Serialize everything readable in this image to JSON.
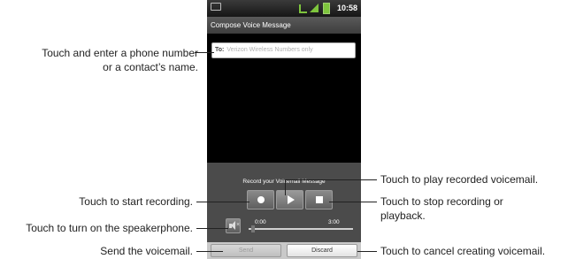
{
  "status_bar": {
    "time": "10:58",
    "icons": [
      "message-icon",
      "usb-icon",
      "signal-icon",
      "battery-icon"
    ]
  },
  "app": {
    "title": "Compose Voice Message",
    "to_label": "To:",
    "to_placeholder": "Verizon Wireless Numbers only"
  },
  "recorder": {
    "title": "Record your Voicemail Message",
    "time_start": "0:00",
    "time_end": "3:00",
    "progress_fraction": 0.0,
    "buttons": [
      "record-icon",
      "play-icon",
      "stop-icon"
    ],
    "speaker_icon": "speaker-muted-icon"
  },
  "buttons": {
    "send": "Send",
    "discard": "Discard"
  },
  "callouts": {
    "phone_number_line1": "Touch and enter a phone number",
    "phone_number_line2": "or a contact’s name.",
    "start_recording": "Touch to start recording.",
    "speakerphone": "Touch to turn on the speakerphone.",
    "send": "Send the voicemail.",
    "play": "Touch to play recorded voicemail.",
    "stop_line1": "Touch to stop recording or",
    "stop_line2": "playback.",
    "cancel": "Touch to cancel creating voicemail."
  },
  "colors": {
    "signal_green": "#7ec53d",
    "panel_gray": "#4b4b4b",
    "phone_background": "#000000"
  }
}
